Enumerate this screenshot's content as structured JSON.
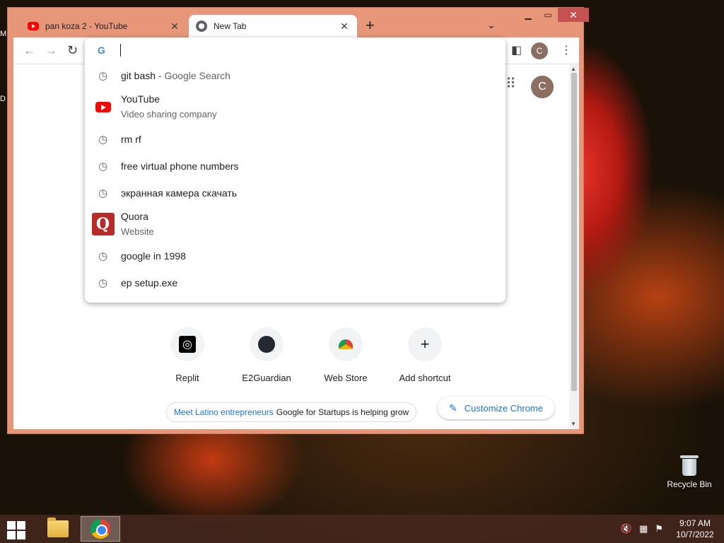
{
  "desktop": {
    "recycle_bin_label": "Recycle Bin"
  },
  "taskbar": {
    "time": "9:07 AM",
    "date": "10/7/2022"
  },
  "browser": {
    "tabs": [
      {
        "title": "pan koza 2 - YouTube",
        "icon": "youtube-icon"
      },
      {
        "title": "New Tab",
        "icon": "chrome-icon"
      }
    ],
    "profile_initial": "C",
    "omnibox": {
      "value": "",
      "suggestions": [
        {
          "icon": "history-icon",
          "text": "git bash",
          "sub": " - Google Search"
        },
        {
          "icon": "youtube-icon",
          "text": "YouTube",
          "desc": "Video sharing company"
        },
        {
          "icon": "history-icon",
          "text": "rm rf"
        },
        {
          "icon": "history-icon",
          "text": "free virtual phone numbers"
        },
        {
          "icon": "history-icon",
          "text": "экранная камера скачать"
        },
        {
          "icon": "quora-icon",
          "text": "Quora",
          "desc": "Website"
        },
        {
          "icon": "history-icon",
          "text": "google in 1998"
        },
        {
          "icon": "history-icon",
          "text": "ep setup.exe"
        }
      ]
    },
    "newtab": {
      "shortcuts": [
        {
          "label": "Replit",
          "icon": "replit-icon"
        },
        {
          "label": "E2Guardian",
          "icon": "github-icon"
        },
        {
          "label": "Web Store",
          "icon": "webstore-icon"
        },
        {
          "label": "Add shortcut",
          "icon": "plus-icon"
        }
      ],
      "promo_link": "Meet Latino entrepreneurs",
      "promo_text": "Google for Startups is helping grow",
      "customize_label": "Customize Chrome"
    }
  },
  "colors": {
    "titlebar": "#e8967a",
    "link": "#1a73e8",
    "close": "#c75050"
  }
}
